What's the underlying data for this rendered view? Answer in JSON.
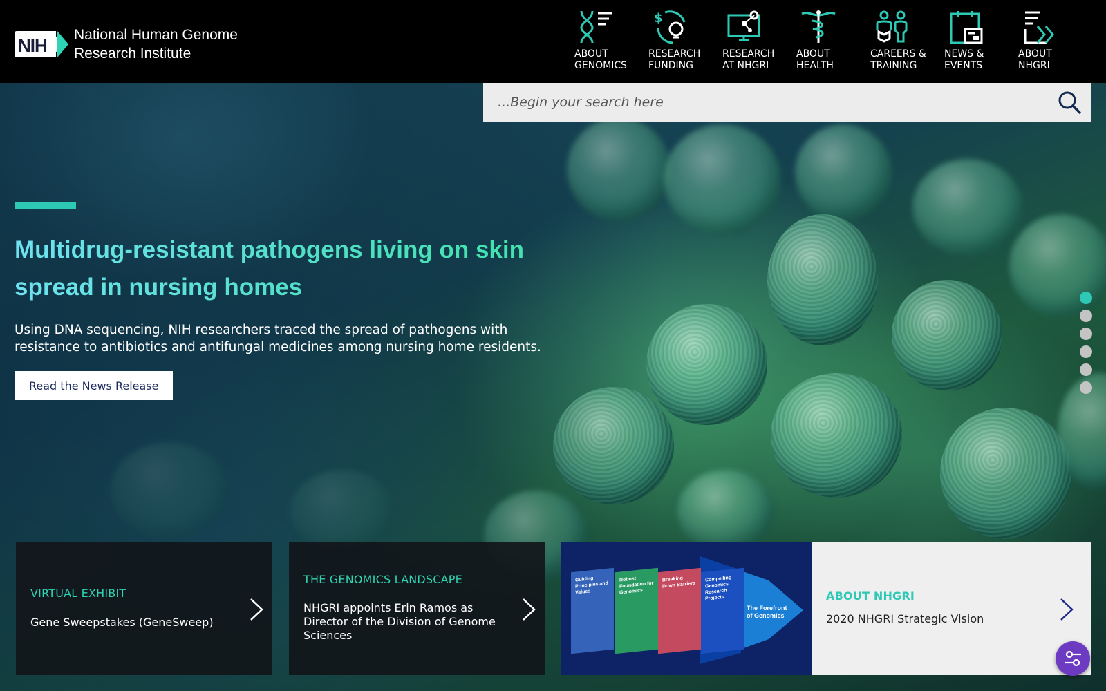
{
  "site": {
    "logo_abbrev": "NIH",
    "name_line1": "National Human Genome",
    "name_line2": "Research Institute"
  },
  "nav": [
    {
      "label": "ABOUT\nGENOMICS",
      "icon": "dna-list-icon"
    },
    {
      "label": "RESEARCH\nFUNDING",
      "icon": "dollar-lightbulb-icon"
    },
    {
      "label": "RESEARCH\nAT NHGRI",
      "icon": "monitor-network-icon"
    },
    {
      "label": "ABOUT\nHEALTH",
      "icon": "caduceus-icon"
    },
    {
      "label": "CAREERS &\nTRAINING",
      "icon": "people-book-icon"
    },
    {
      "label": "NEWS &\nEVENTS",
      "icon": "calendar-icon"
    },
    {
      "label": "ABOUT\nNHGRI",
      "icon": "document-arrow-icon"
    }
  ],
  "search": {
    "placeholder": "...Begin your search here"
  },
  "hero": {
    "headline": "Multidrug-resistant pathogens living on skin spread in nursing homes",
    "subtext": "Using DNA sequencing, NIH researchers traced the spread of pathogens with resistance to antibiotics and antifungal medicines among nursing home residents.",
    "cta_label": "Read the News Release",
    "slide_count": 6,
    "active_slide": 1
  },
  "cards": [
    {
      "kicker": "VIRTUAL EXHIBIT",
      "title": "Gene Sweepstakes (GeneSweep)"
    },
    {
      "kicker": "THE GENOMICS LANDSCAPE",
      "title": "NHGRI appoints Erin Ramos as Director of the Division of Genome Sciences"
    },
    {
      "kicker": "ABOUT NHGRI",
      "title": "2020 NHGRI Strategic Vision"
    }
  ],
  "promo_panels": [
    "Guiding Principles and Values",
    "Robust Foundation for Genomics",
    "Breaking Down Barriers",
    "Compelling Genomics Research Projects",
    "The Forefront of Genomics"
  ],
  "colors": {
    "accent": "#2ec9b5",
    "header_bg": "#000000",
    "cta_text": "#1c2a5e",
    "a11y": "#6d3bc2"
  }
}
